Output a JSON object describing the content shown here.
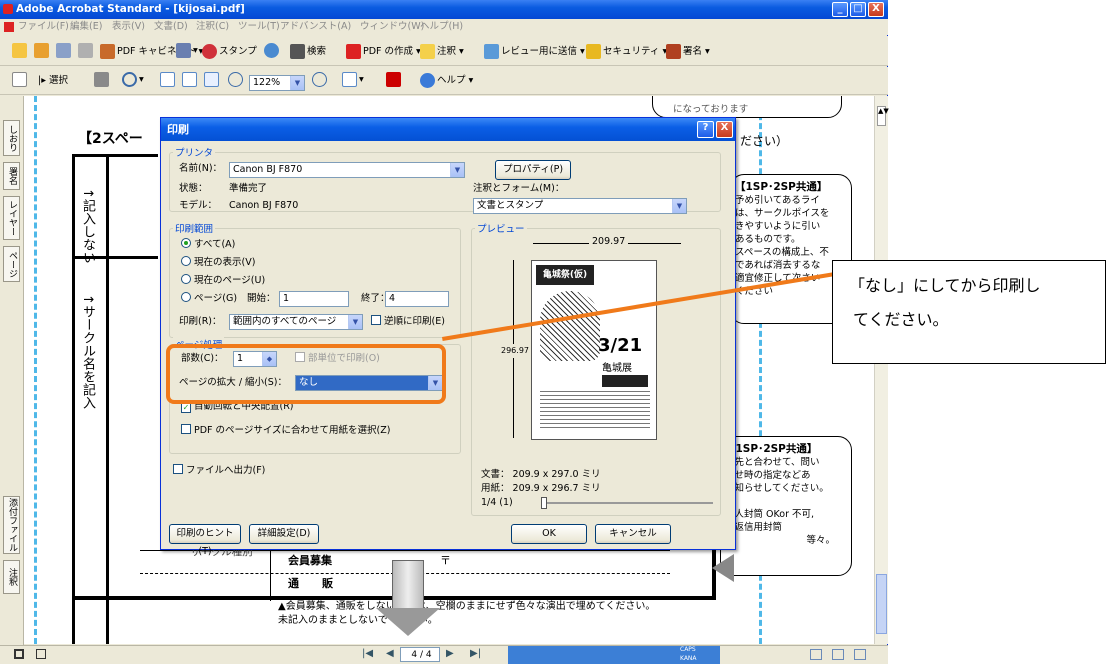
{
  "window": {
    "title": "Adobe Acrobat Standard - [kijosai.pdf]",
    "minimize": "_",
    "maximize": "□",
    "close": "X"
  },
  "menu": [
    "ファイル(F)",
    "編集(E)",
    "表示(V)",
    "文書(D)",
    "注釈(C)",
    "ツール(T)",
    "アドバンスト(A)",
    "ウィンドウ(W)",
    "ヘルプ(H)"
  ],
  "toolbar1": {
    "cabinet": "PDF キャビネット",
    "stamp": "スタンプ",
    "search": "検索",
    "create_pdf": "PDF の作成",
    "comment": "注釈",
    "review": "レビュー用に送信",
    "security": "セキュリティ",
    "sign": "署名"
  },
  "toolbar2": {
    "select": "選択",
    "zoom": "122%",
    "help": "ヘルプ",
    "yahoo": "Y!"
  },
  "left_tabs": [
    "しおり",
    "署名",
    "レイヤー",
    "ページ",
    "添付ファイル",
    "注釈"
  ],
  "document": {
    "heading": "【2スペー",
    "vertical1": "↑記入しない",
    "vertical2": "↑サークル名を記入",
    "top_note": "になっております",
    "top_note_tail": "ださい）",
    "box1": [
      "【1SP･2SP共通】",
      "予め引いてあるライ",
      "は、サークルポイスを",
      "きやすいように引い",
      "あるものです。",
      "スペースの構成上、不",
      "であれば消去するな",
      "適宜修正して次さい",
      "ください"
    ],
    "box2": [
      "【1SP･2SP共通】",
      "紹先と合わせて、問い",
      "わせ時の指定などあ",
      "お知らせしてください。",
      ")",
      "同人封筒 OKor 不可,",
      "要返信用封筒",
      "等々。"
    ],
    "table_row1": [
      "サークル種別",
      "会員募集",
      "〒"
    ],
    "table_row2": [
      "通",
      "販"
    ],
    "footer_note1": "▲会員募集、通販をしない場合は、空欄のままにせず色々な演出で埋めてください。",
    "footer_note2": "未記入のままとしないでください。"
  },
  "callout": {
    "line1": "「なし」にしてから印刷し",
    "line2": "てください。"
  },
  "dialog": {
    "title": "印刷",
    "help_btn": "?",
    "close_btn": "X",
    "printer_group": "プリンタ",
    "name_label": "名前(N)：",
    "name_value": "Canon BJ F870",
    "status_label": "状態：",
    "status_value": "準備完了",
    "model_label": "モデル：",
    "model_value": "Canon BJ F870",
    "properties_btn": "プロパティ(P)",
    "comments_label": "注釈とフォーム(M)：",
    "comments_value": "文書とスタンプ",
    "range_group": "印刷範囲",
    "all": "すべて(A)",
    "current_view": "現在の表示(V)",
    "current_page": "現在のページ(U)",
    "pages": "ページ(G)",
    "start_label": "開始：",
    "start_value": "1",
    "end_label": "終了：",
    "end_value": "4",
    "print_label": "印刷(R)：",
    "print_value": "範囲内のすべてのページ",
    "reverse": "逆順に印刷(E)",
    "page_group": "ページ処理",
    "copies_label": "部数(C)：",
    "copies_value": "1",
    "collate": "部単位で印刷(O)",
    "scale_label": "ページの拡大 / 縮小(S)：",
    "scale_value": "なし",
    "autorotate": "自動回転と中央配置(R)",
    "pdf_size": "PDF のページサイズに合わせて用紙を選択(Z)",
    "print_to_file": "ファイルへ出力(F)",
    "preview_group": "プレビュー",
    "preview_width": "209.97",
    "preview_height": "296.97",
    "doc_size": "文書：  209.9 x 297.0 ミリ",
    "paper_size": "用紙：  209.9 x 296.7 ミリ",
    "page_of": "1/4 (1)",
    "tips_btn": "印刷のヒント(T)",
    "advanced_btn": "詳細設定(D)",
    "ok_btn": "OK",
    "cancel_btn": "キャンセル",
    "poster_title": "亀城祭(仮)",
    "poster_date": "3/21",
    "poster_sub": "亀城展"
  },
  "status": {
    "page_display": "4 / 4",
    "caps": "CAPS",
    "kana": "KANA"
  }
}
